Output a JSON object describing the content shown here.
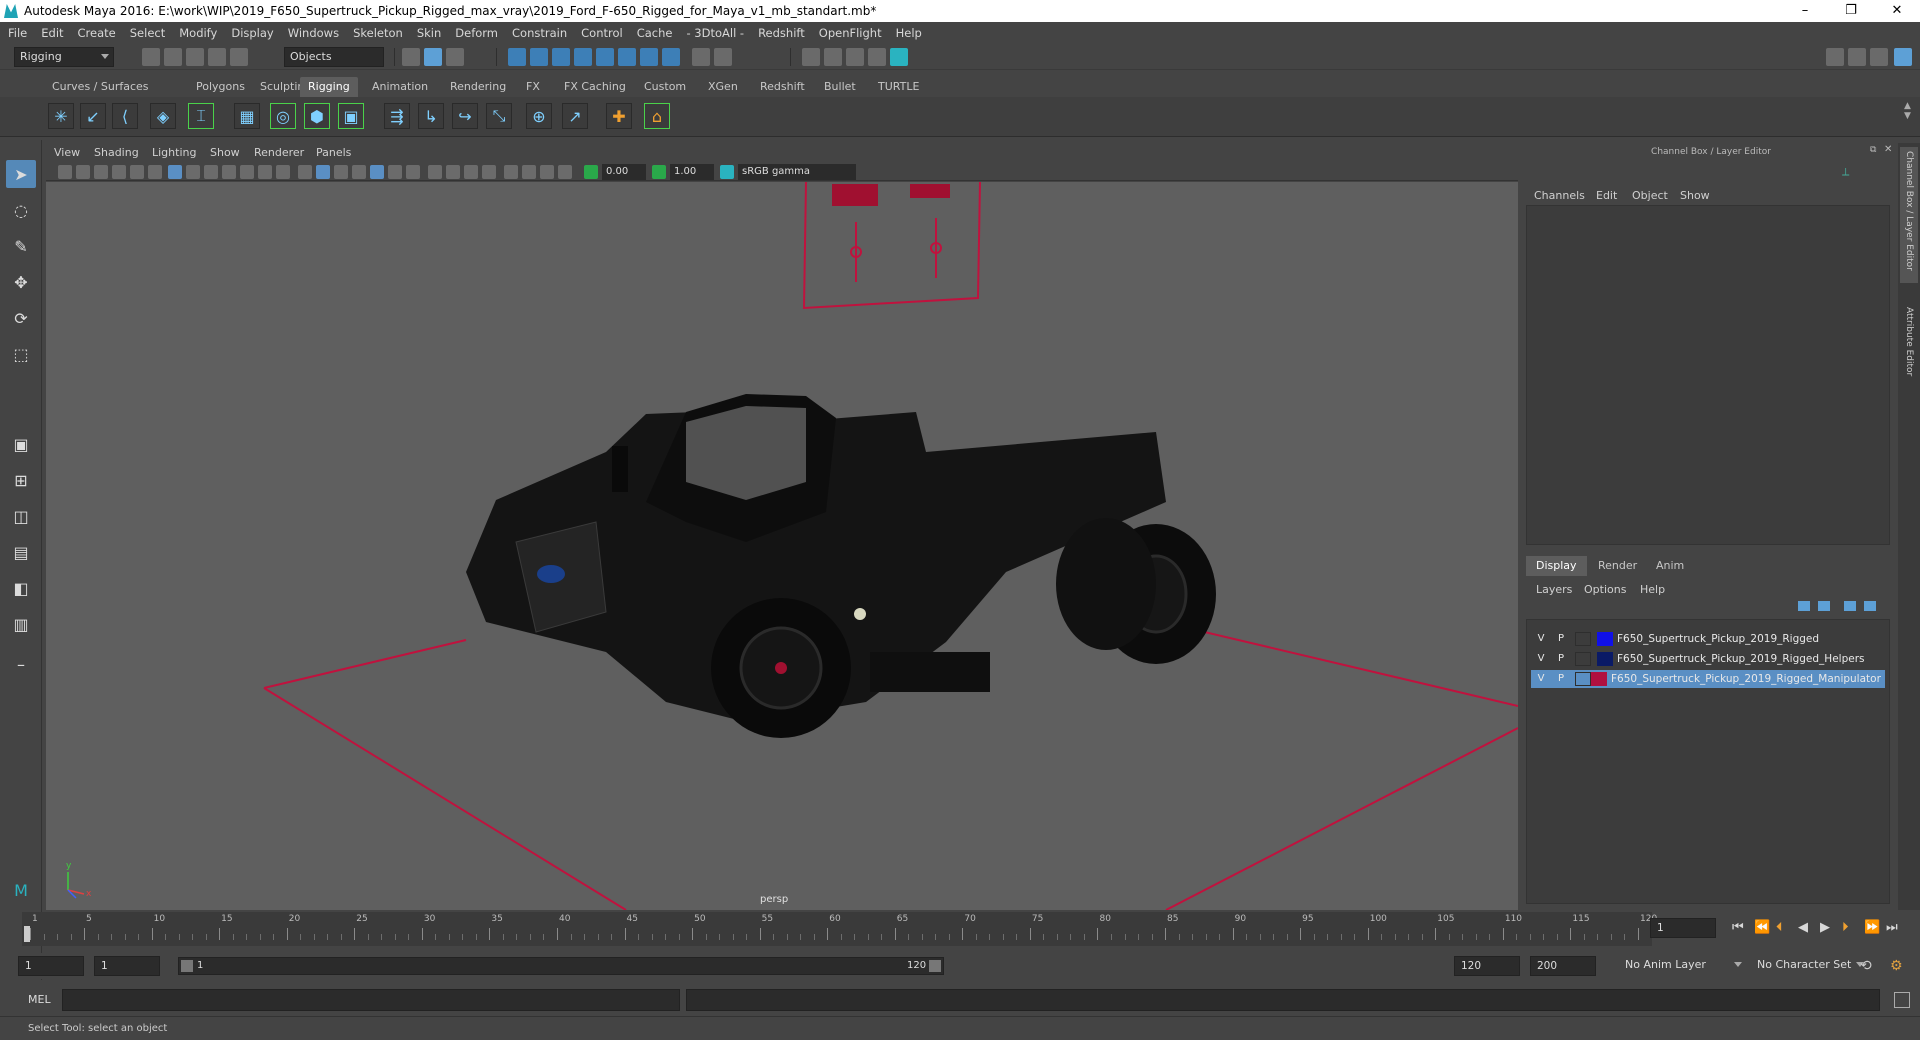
{
  "window": {
    "title": "Autodesk Maya 2016: E:\\work\\WIP\\2019_F650_Supertruck_Pickup_Rigged_max_vray\\2019_Ford_F-650_Rigged_for_Maya_v1_mb_standart.mb*",
    "minimize": "–",
    "restore": "❐",
    "close": "✕"
  },
  "menubar": [
    "File",
    "Edit",
    "Create",
    "Select",
    "Modify",
    "Display",
    "Windows",
    "Skeleton",
    "Skin",
    "Deform",
    "Constrain",
    "Control",
    "Cache",
    "- 3DtoAll -",
    "Redshift",
    "OpenFlight",
    "Help"
  ],
  "statusline": {
    "menuset": "Rigging",
    "selection_mode": "Objects"
  },
  "shelf_tabs": [
    "Curves / Surfaces",
    "Polygons",
    "Sculpting",
    "Rigging",
    "Animation",
    "Rendering",
    "FX",
    "FX Caching",
    "Custom",
    "XGen",
    "Redshift",
    "Bullet",
    "TURTLE"
  ],
  "shelf_active_tab": "Rigging",
  "viewport": {
    "menu": [
      "View",
      "Shading",
      "Lighting",
      "Show",
      "Renderer",
      "Panels"
    ],
    "exposure": "0.00",
    "gamma": "1.00",
    "color_space": "sRGB gamma",
    "camera_label": "persp",
    "axis_y": "y",
    "axis_x": "x"
  },
  "channel_box": {
    "title": "Channel Box / Layer Editor",
    "menu": [
      "Channels",
      "Edit",
      "Object",
      "Show"
    ]
  },
  "layer_editor": {
    "tabs": [
      "Display",
      "Render",
      "Anim"
    ],
    "active_tab": "Display",
    "menu": [
      "Layers",
      "Options",
      "Help"
    ],
    "layers": [
      {
        "v": "V",
        "p": "P",
        "color": "#1010e8",
        "name": "F650_Supertruck_Pickup_2019_Rigged",
        "selected": false
      },
      {
        "v": "V",
        "p": "P",
        "color": "#0a1a66",
        "name": "F650_Supertruck_Pickup_2019_Rigged_Helpers",
        "selected": false
      },
      {
        "v": "V",
        "p": "P",
        "color": "#b01040",
        "name": "F650_Supertruck_Pickup_2019_Rigged_Manipulator",
        "selected": true
      }
    ]
  },
  "side_tabs": [
    "Channel Box / Layer Editor",
    "Attribute Editor"
  ],
  "time_slider": {
    "ticks": [
      "1",
      "5",
      "10",
      "15",
      "20",
      "25",
      "30",
      "35",
      "40",
      "45",
      "50",
      "55",
      "60",
      "65",
      "70",
      "75",
      "80",
      "85",
      "90",
      "95",
      "100",
      "105",
      "110",
      "115",
      "120"
    ],
    "current_frame": "1"
  },
  "range_slider": {
    "start": "1",
    "playback_start": "1",
    "range_start_label": "1",
    "range_end_label": "120",
    "playback_end": "120",
    "end": "200",
    "anim_layer": "No Anim Layer",
    "character_set": "No Character Set"
  },
  "command_line": {
    "label": "MEL"
  },
  "help_line": "Select Tool: select an object"
}
